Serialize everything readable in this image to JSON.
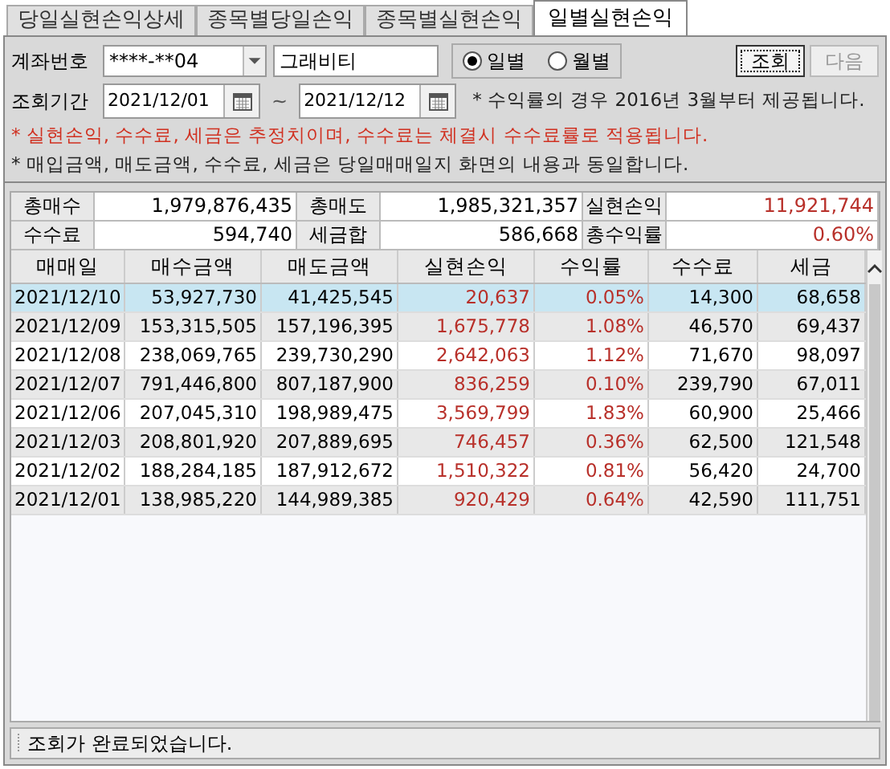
{
  "tabs": [
    {
      "label": "당일실현손익상세",
      "selected": false
    },
    {
      "label": "종목별당일손익",
      "selected": false
    },
    {
      "label": "종목별실현손익",
      "selected": false
    },
    {
      "label": "일별실현손익",
      "selected": true
    }
  ],
  "account": {
    "label": "계좌번호",
    "value": "****-**04",
    "name": "그래비티"
  },
  "period_mode": [
    {
      "label": "일별",
      "selected": true
    },
    {
      "label": "월별",
      "selected": false
    }
  ],
  "buttons": [
    {
      "label": "조회",
      "disabled": false
    },
    {
      "label": "다음",
      "disabled": true
    }
  ],
  "period": {
    "label": "조회기간",
    "from": "2021/12/01",
    "separator": "~",
    "to": "2021/12/12",
    "note": "* 수익률의 경우 2016년 3월부터 제공됩니다."
  },
  "notices": [
    {
      "text": "* 실현손익, 수수료, 세금은 추정치이며, 수수료는 체결시 수수료률로 적용됩니다.",
      "kind": "warning"
    },
    {
      "text": "* 매입금액, 매도금액, 수수료, 세금은 당일매매일지 화면의 내용과 동일합니다.",
      "kind": "info"
    }
  ],
  "summary": [
    [
      {
        "label": "총매수",
        "value": "1,979,876,435",
        "negative": false
      },
      {
        "label": "총매도",
        "value": "1,985,321,357",
        "negative": false
      },
      {
        "label": "실현손익",
        "value": "11,921,744",
        "negative": true
      }
    ],
    [
      {
        "label": "수수료",
        "value": "594,740",
        "negative": false
      },
      {
        "label": "세금합",
        "value": "586,668",
        "negative": false
      },
      {
        "label": "총수익률",
        "value": "0.60%",
        "negative": true
      }
    ]
  ],
  "table": {
    "columns": [
      "매매일",
      "매수금액",
      "매도금액",
      "실현손익",
      "수익률",
      "수수료",
      "세금"
    ],
    "rows": [
      {
        "selected": true,
        "cells": [
          "2021/12/10",
          "53,927,730",
          "41,425,545",
          "20,637",
          "0.05%",
          "14,300",
          "68,658"
        ]
      },
      {
        "selected": false,
        "cells": [
          "2021/12/09",
          "153,315,505",
          "157,196,395",
          "1,675,778",
          "1.08%",
          "46,570",
          "69,437"
        ]
      },
      {
        "selected": false,
        "cells": [
          "2021/12/08",
          "238,069,765",
          "239,730,290",
          "2,642,063",
          "1.12%",
          "71,670",
          "98,097"
        ]
      },
      {
        "selected": false,
        "cells": [
          "2021/12/07",
          "791,446,800",
          "807,187,900",
          "836,259",
          "0.10%",
          "239,790",
          "67,011"
        ]
      },
      {
        "selected": false,
        "cells": [
          "2021/12/06",
          "207,045,310",
          "198,989,475",
          "3,569,799",
          "1.83%",
          "60,900",
          "25,466"
        ]
      },
      {
        "selected": false,
        "cells": [
          "2021/12/03",
          "208,801,920",
          "207,889,695",
          "746,457",
          "0.36%",
          "62,500",
          "121,548"
        ]
      },
      {
        "selected": false,
        "cells": [
          "2021/12/02",
          "188,284,185",
          "187,912,672",
          "1,510,322",
          "0.81%",
          "56,420",
          "24,700"
        ]
      },
      {
        "selected": false,
        "cells": [
          "2021/12/01",
          "138,985,220",
          "144,989,385",
          "920,429",
          "0.64%",
          "42,590",
          "111,751"
        ]
      }
    ]
  },
  "status_bar": "조회가 완료되었습니다."
}
